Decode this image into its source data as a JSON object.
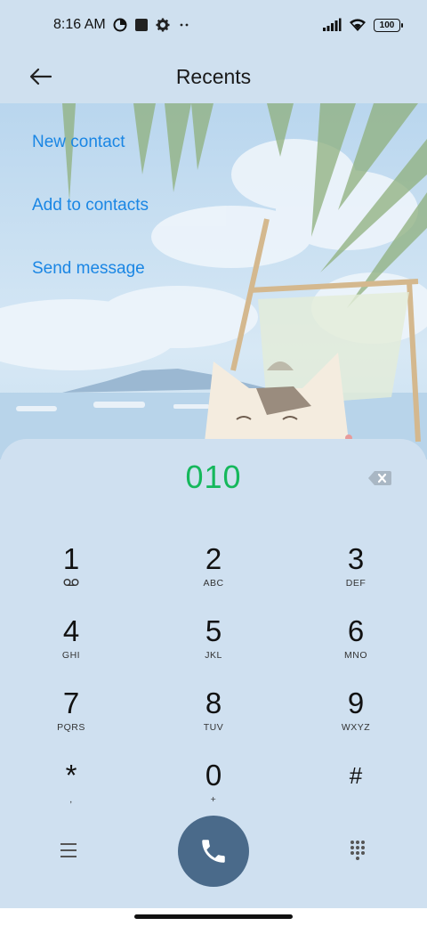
{
  "status_bar": {
    "time": "8:16 AM",
    "battery": "100",
    "icons": [
      "data-saver-icon",
      "square-notification-icon",
      "settings-gear-icon",
      "more-dots-icon",
      "signal-icon",
      "wifi-icon",
      "battery-icon"
    ]
  },
  "header": {
    "title": "Recents",
    "back_icon": "arrow-left-icon"
  },
  "actions": {
    "new_contact": "New contact",
    "add_to_contacts": "Add to contacts",
    "send_message": "Send message"
  },
  "dialer": {
    "number": "010",
    "number_color": "#15b85c",
    "keys": [
      {
        "digit": "1",
        "letters": ""
      },
      {
        "digit": "2",
        "letters": "ABC"
      },
      {
        "digit": "3",
        "letters": "DEF"
      },
      {
        "digit": "4",
        "letters": "GHI"
      },
      {
        "digit": "5",
        "letters": "JKL"
      },
      {
        "digit": "6",
        "letters": "MNO"
      },
      {
        "digit": "7",
        "letters": "PQRS"
      },
      {
        "digit": "8",
        "letters": "TUV"
      },
      {
        "digit": "9",
        "letters": "WXYZ"
      },
      {
        "digit": "*",
        "letters": ","
      },
      {
        "digit": "0",
        "letters": "+"
      },
      {
        "digit": "#",
        "letters": ""
      }
    ],
    "call_button_color": "#4a6a8a"
  },
  "colors": {
    "accent_link": "#1a86e4",
    "background": "#cfe0ef"
  }
}
